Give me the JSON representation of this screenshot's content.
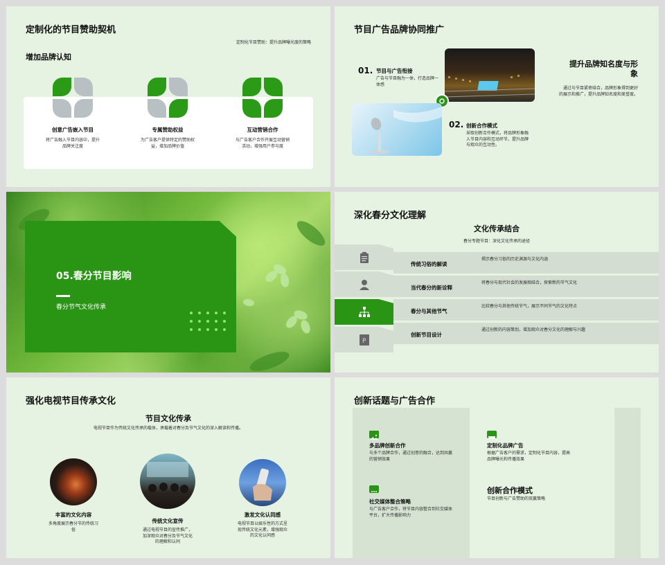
{
  "slide1": {
    "title": "定制化的节目赞助契机",
    "subtitle_right": "定制化节目赞助：提升品牌曝光度的策略",
    "section": "增加品牌认知",
    "features": [
      {
        "title": "创意广告嵌入节目",
        "desc1": "将广告融入节目内容中，提升",
        "desc2": "品牌关注度"
      },
      {
        "title": "专属赞助权益",
        "desc1": "为广告客户提供特定的赞助权",
        "desc2": "益，增加品牌价值"
      },
      {
        "title": "互动营销合作",
        "desc1": "与广告客户合作开展互动营销",
        "desc2": "活动，增强用户参与度"
      }
    ]
  },
  "slide2": {
    "title": "节目广告品牌协同推广",
    "item1": {
      "num": "01.",
      "title": "节目与广告衔接",
      "desc1": "广告与节目融为一体，打造品牌一",
      "desc2": "体感"
    },
    "item2": {
      "num": "02.",
      "title": "创新合作模式",
      "desc1": "采取创新合作模式，将品牌形象融",
      "desc2": "入节目内容和互动环节，提升品牌",
      "desc3": "与观众的互动性。"
    },
    "right_title1": "提升品牌知名度与形",
    "right_title2": "象",
    "right_desc1": "通过与节目紧密结合，品牌形象得到更好",
    "right_desc2": "的展示和推广，提升品牌知名度和美誉度。"
  },
  "slide3": {
    "title": "05.春分节目影响",
    "subtitle": "春分节气文化传承"
  },
  "slide4": {
    "title": "深化春分文化理解",
    "heading": "文化传承结合",
    "sub": "春分专题节目：深化文化传承的途径",
    "rows": [
      {
        "label": "传统习俗的解读",
        "desc": "揭示春分习俗的历史渊源与文化内涵"
      },
      {
        "label": "当代春分的新诠释",
        "desc": "将春分与现代社会的发展相结合，探索新的节气文化"
      },
      {
        "label": "春分与其他节气",
        "desc": "比较春分与其他传统节气，展示不同节气的文化特点"
      },
      {
        "label": "创新节目设计",
        "desc": "通过创新的内容策划，增加观众对春分文化的理解与兴趣"
      }
    ]
  },
  "slide5": {
    "title": "强化电视节目传承文化",
    "heading": "节目文化传承",
    "sub": "电视节目作为传统文化传承的载体，承载着对春分及节气文化的深入解读和传播。",
    "items": [
      {
        "title": "丰富的文化内容",
        "desc1": "多角度展示春分节的传统习",
        "desc2": "俗",
        "desc3": ""
      },
      {
        "title": "传统文化宣传",
        "desc1": "通过电视节目的宣传推广，",
        "desc2": "加深观众对春分及节气文化",
        "desc3": "的理解和认同"
      },
      {
        "title": "激发文化认同感",
        "desc1": "电视节目以娱乐性的方式呈",
        "desc2": "现传统文化元素，增强观众",
        "desc3": "的文化认同感"
      }
    ]
  },
  "slide6": {
    "title": "创新话题与广告合作",
    "items": [
      {
        "title": "多品牌创新合作",
        "desc1": "与多个品牌合作，通过创意的融合，达到共赢",
        "desc2": "的营销效果"
      },
      {
        "title": "定制化品牌广告",
        "desc1": "根据广告客户的需求，定制化节目内容，提高",
        "desc2": "品牌曝光和传播效果"
      },
      {
        "title": "社交媒体整合策略",
        "desc1": "与广告客户合作，将节目内容整合到社交媒体",
        "desc2": "平台，扩大传播影响力"
      }
    ],
    "right_title": "创新合作模式",
    "right_sub": "节目创新与广告赞助的双赢策略"
  },
  "colors": {
    "accent": "#2a9515",
    "bg": "#e6f2e2",
    "light_green": "#8bea6a"
  }
}
